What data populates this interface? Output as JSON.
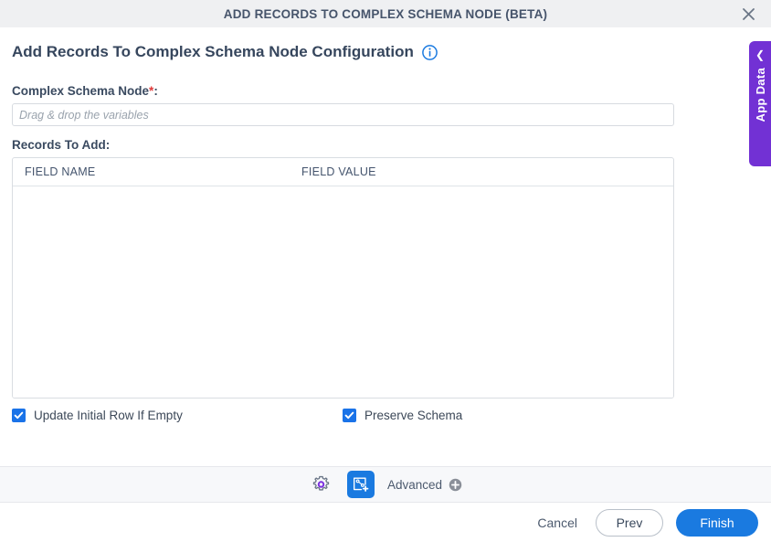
{
  "window": {
    "title": "ADD RECORDS TO COMPLEX SCHEMA NODE (BETA)",
    "close_icon": "close-icon"
  },
  "page": {
    "heading": "Add Records To Complex Schema Node Configuration",
    "info_icon": "info-icon"
  },
  "form": {
    "complex_schema_node": {
      "label": "Complex Schema Node",
      "required_marker": "*",
      "colon": ":",
      "value": "",
      "placeholder": "Drag & drop the variables"
    },
    "records_to_add": {
      "label": "Records To Add:",
      "columns": [
        "FIELD NAME",
        "FIELD VALUE"
      ],
      "rows": []
    },
    "checkboxes": [
      {
        "label": "Update Initial Row If Empty",
        "checked": true
      },
      {
        "label": "Preserve Schema",
        "checked": true
      }
    ]
  },
  "toolbar": {
    "settings_icon": "gear-icon",
    "variables_icon": "add-variable-icon",
    "advanced_label": "Advanced",
    "advanced_add_icon": "plus-circle-icon"
  },
  "footer": {
    "cancel_label": "Cancel",
    "prev_label": "Prev",
    "finish_label": "Finish"
  },
  "side_panel": {
    "label": "App Data",
    "collapse_icon": "chevron-left-icon"
  },
  "colors": {
    "accent_blue": "#1a7ae0",
    "checkbox_blue": "#1a73e8",
    "app_data_purple": "#7231d4",
    "required_red": "#e03a3a",
    "titlebar_bg": "#eff0f2",
    "toolbar_bg": "#f7f8fa"
  }
}
